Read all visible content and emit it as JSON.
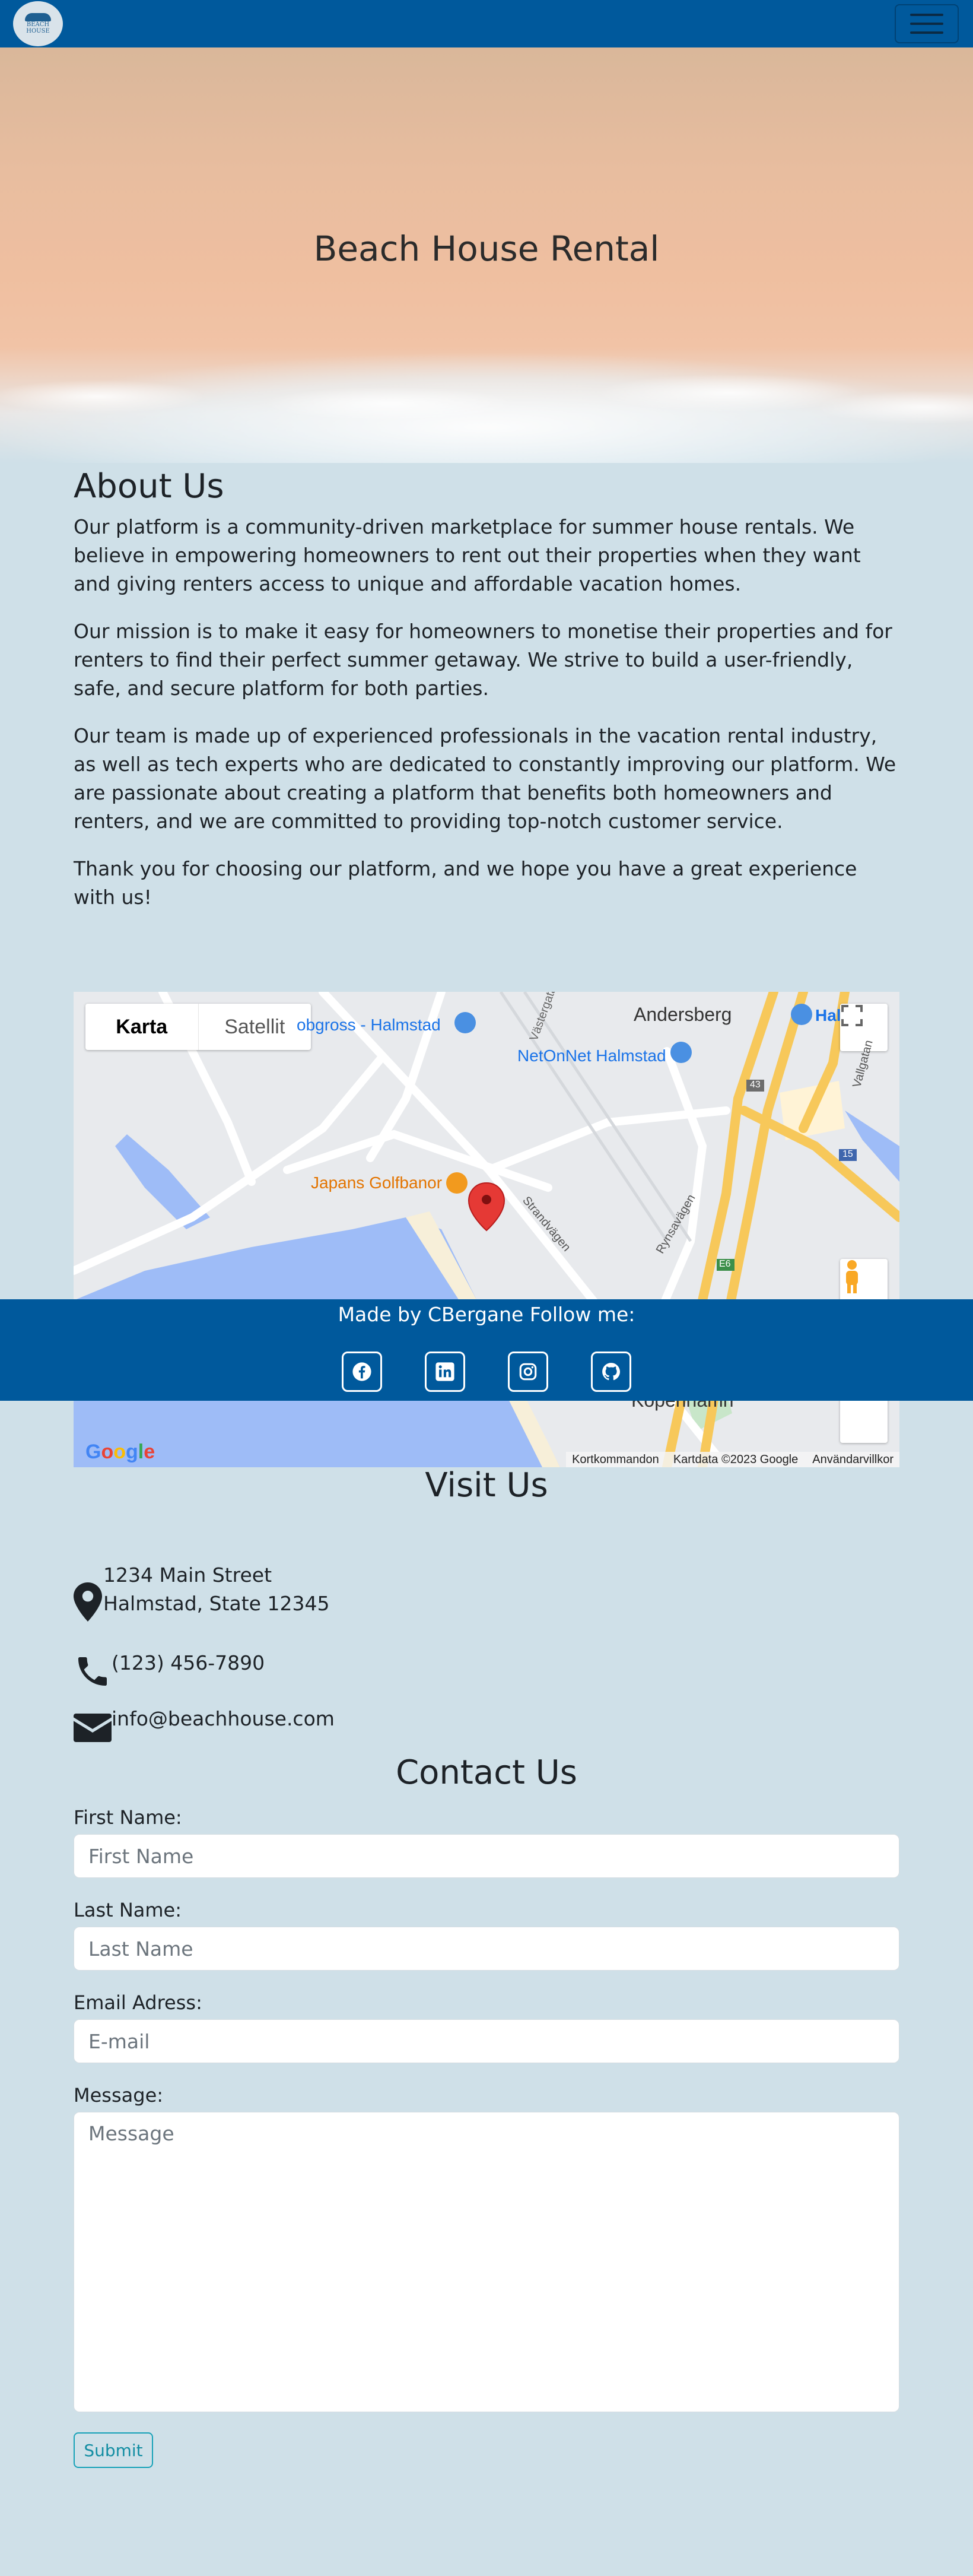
{
  "navbar": {
    "logo_text_line1": "BEACH",
    "logo_text_line2": "HOUSE"
  },
  "hero": {
    "title": "Beach House Rental"
  },
  "about": {
    "heading": "About Us",
    "paragraphs": [
      "Our platform is a community-driven marketplace for summer house rentals. We believe in empowering homeowners to rent out their properties when they want and giving renters access to unique and affordable vacation homes.",
      "Our mission is to make it easy for homeowners to monetise their properties and for renters to find their perfect summer getaway. We strive to build a user-friendly, safe, and secure platform for both parties.",
      "Our team is made up of experienced professionals in the vacation rental industry, as well as tech experts who are dedicated to constantly improving our platform. We are passionate about creating a platform that benefits both homeowners and renters, and we are committed to providing top-notch customer service.",
      "Thank you for choosing our platform, and we hope you have a great experience with us!"
    ]
  },
  "map": {
    "type_map": "Karta",
    "type_satellite": "Satellit",
    "labels": {
      "andersberg": "Andersberg",
      "bobgross": "obgross - Halmstad",
      "netonnet": "NetOnNet Halmstad",
      "golf": "Japans Golfbanor",
      "kopenhamn": "Köpenhamn",
      "hal": "Hal",
      "road1": "Västergatan",
      "road2": "Strandvägen",
      "road3": "Rynsavägen",
      "road4": "Vallgatan",
      "e6": "E6",
      "r15": "15",
      "r43": "43"
    },
    "google": "Google",
    "footer": [
      "Kortkommandon",
      "Kartdata ©2023 Google",
      "Användarvillkor"
    ]
  },
  "footer": {
    "text": "Made by CBergane Follow me:",
    "social": [
      "facebook-icon",
      "linkedin-icon",
      "instagram-icon",
      "github-icon"
    ]
  },
  "visit": {
    "heading": "Visit Us",
    "address_line1": "1234 Main Street",
    "address_line2": "Halmstad, State 12345",
    "phone": "(123) 456-7890",
    "email": "info@beachhouse.com"
  },
  "contact": {
    "heading": "Contact Us",
    "first_name_label": "First Name:",
    "first_name_placeholder": "First Name",
    "last_name_label": "Last Name:",
    "last_name_placeholder": "Last Name",
    "email_label": "Email Adress:",
    "email_placeholder": "E-mail",
    "message_label": "Message:",
    "message_placeholder": "Message",
    "submit": "Submit"
  },
  "colors": {
    "navbar": "#00599c",
    "page_bg": "#cfe0e8",
    "submit_accent": "#17a2b8",
    "map_water": "#9ebcf7",
    "map_pin": "#e53935"
  }
}
